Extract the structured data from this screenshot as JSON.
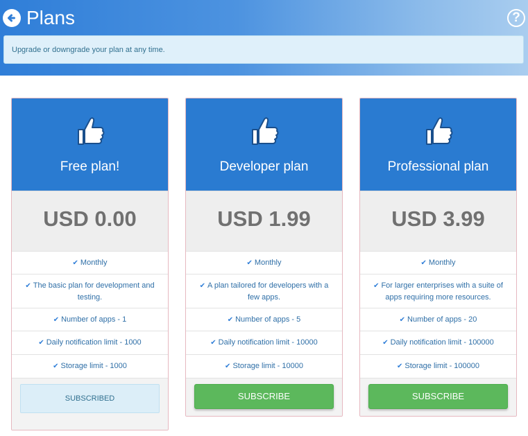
{
  "header": {
    "title": "Plans",
    "back_icon": "back-arrow-circle-icon",
    "help_icon": "help-circle-icon",
    "help_glyph": "?"
  },
  "notice": {
    "text": "Upgrade or downgrade your plan at any time."
  },
  "colors": {
    "plan_header": "#2a7bd1",
    "subscribe_button": "#5cb85c",
    "subscribed_button": "#dceef8",
    "price_text": "#707070",
    "feature_text": "#2f6fa7"
  },
  "plans": [
    {
      "name": "Free plan!",
      "icon": "thumbs-up-icon",
      "price": "USD 0.00",
      "features": [
        "Monthly",
        "The basic plan for development and testing.",
        "Number of apps - 1",
        "Daily notification limit - 1000",
        "Storage limit - 1000"
      ],
      "button_label": "SUBSCRIBED",
      "subscribed": true
    },
    {
      "name": "Developer plan",
      "icon": "thumbs-up-icon",
      "price": "USD 1.99",
      "features": [
        "Monthly",
        "A plan tailored for developers with a few apps.",
        "Number of apps - 5",
        "Daily notification limit - 10000",
        "Storage limit - 10000"
      ],
      "button_label": "SUBSCRIBE",
      "subscribed": false
    },
    {
      "name": "Professional plan",
      "icon": "thumbs-up-icon",
      "price": "USD 3.99",
      "features": [
        "Monthly",
        "For larger enterprises with a suite of apps requiring more resources.",
        "Number of apps - 20",
        "Daily notification limit - 100000",
        "Storage limit - 100000"
      ],
      "button_label": "SUBSCRIBE",
      "subscribed": false
    }
  ]
}
